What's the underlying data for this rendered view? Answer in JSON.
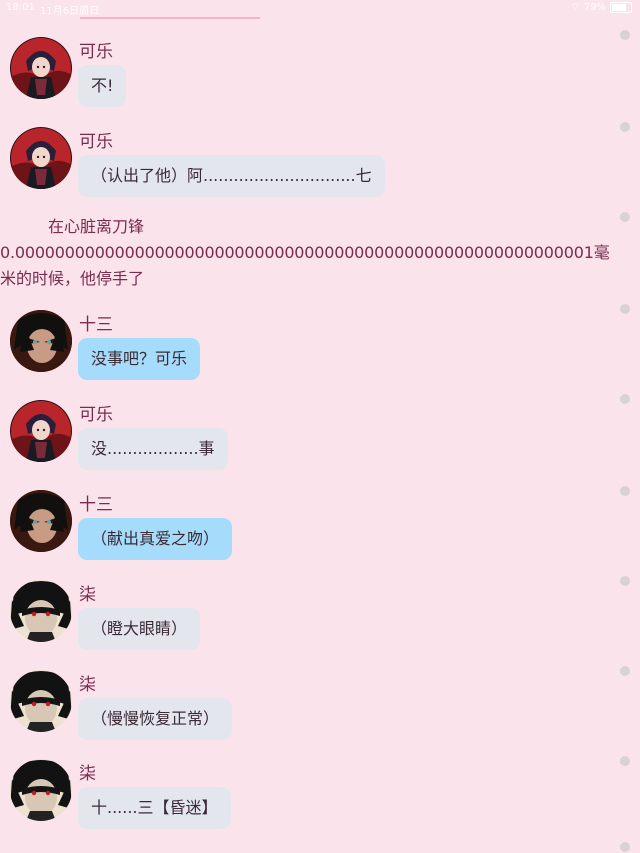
{
  "status_bar": {
    "time": "18:01",
    "date": "11月6日周日",
    "battery": "79%"
  },
  "messages": [
    {
      "name": "可乐",
      "text": "不!",
      "avatar": "cola-avatar"
    },
    {
      "name": "可乐",
      "text": "（认出了他）阿..............................七",
      "avatar": "cola-avatar"
    },
    {
      "name": "十三",
      "text": "没事吧？可乐",
      "avatar": "shisan-avatar"
    },
    {
      "name": "可乐",
      "text": "没..................事",
      "avatar": "cola-avatar"
    },
    {
      "name": "十三",
      "text": "（献出真爱之吻）",
      "avatar": "shisan-avatar"
    },
    {
      "name": "柒",
      "text": "（瞪大眼睛）",
      "avatar": "qi-avatar"
    },
    {
      "name": "柒",
      "text": "（慢慢恢复正常）",
      "avatar": "qi-avatar"
    },
    {
      "name": "柒",
      "text": "十......三【昏迷】",
      "avatar": "qi-avatar"
    }
  ],
  "narration": {
    "line1": "在心脏离刀锋",
    "line2": "0.0000000000000000000000000000000000000000000000000000000001毫",
    "line3": "米的时候，他停手了"
  },
  "colors": {
    "background": "#fbe3ec",
    "name_text": "#7a2b4e",
    "bubble_gray": "#e4e6ee",
    "bubble_blue": "#a6dcfb"
  }
}
